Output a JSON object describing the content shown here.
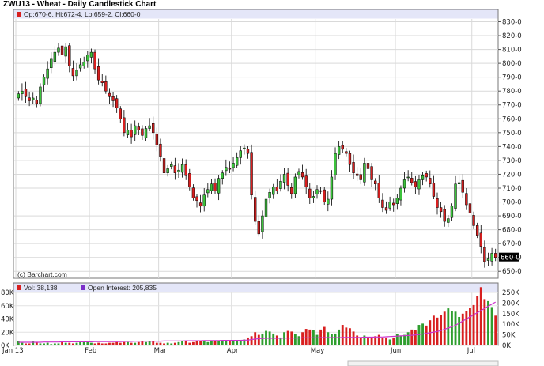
{
  "chart_data": [
    {
      "type": "candlestick",
      "title": "ZWU13 - Wheat - Daily Candlestick Chart",
      "ohlc_label": "Op:670-6, Hi:672-4, Lo:659-2, Cl:660-0",
      "last_price_label": "660-0",
      "copyright": "(c) Barchart.com",
      "x_ticks": [
        "Jan 13",
        "Feb",
        "Mar",
        "Apr",
        "May",
        "Jun",
        "Jul"
      ],
      "y_ticks": [
        "830-0",
        "820-0",
        "810-0",
        "800-0",
        "790-0",
        "780-0",
        "770-0",
        "760-0",
        "750-0",
        "740-0",
        "730-0",
        "720-0",
        "710-0",
        "700-0",
        "690-0",
        "680-0",
        "670-0",
        "660-0",
        "650-0"
      ],
      "ylim": [
        645,
        832
      ],
      "grid": true,
      "colors": {
        "up": "#3cc33c",
        "down": "#d81f1f",
        "wick": "#000000",
        "legend_bg": "#e4e6f8"
      },
      "closes": [
        778,
        780,
        776,
        773,
        775,
        771,
        783,
        790,
        796,
        803,
        808,
        811,
        806,
        812,
        798,
        791,
        795,
        799,
        801,
        806,
        808,
        796,
        788,
        786,
        780,
        776,
        773,
        768,
        760,
        750,
        752,
        747,
        755,
        752,
        748,
        753,
        755,
        750,
        741,
        733,
        721,
        724,
        727,
        721,
        723,
        727,
        719,
        711,
        703,
        701,
        697,
        705,
        709,
        713,
        708,
        717,
        721,
        725,
        724,
        728,
        732,
        737,
        739,
        735,
        705,
        686,
        677,
        690,
        702,
        707,
        711,
        708,
        715,
        720,
        712,
        706,
        718,
        722,
        718,
        711,
        703,
        704,
        709,
        708,
        700,
        702,
        718,
        735,
        740,
        738,
        735,
        727,
        721,
        719,
        716,
        728,
        724,
        716,
        713,
        703,
        696,
        694,
        700,
        698,
        703,
        710,
        716,
        718,
        714,
        711,
        716,
        719,
        718,
        713,
        704,
        696,
        693,
        686,
        688,
        697,
        713,
        714,
        707,
        698,
        692,
        683,
        676,
        668,
        657,
        659,
        663,
        660
      ]
    },
    {
      "type": "bar",
      "title": "",
      "volume_label": "Vol: 38,138",
      "open_interest_label": "Open Interest: 205,835",
      "y_ticks_left": [
        "80K",
        "60K",
        "40K",
        "20K",
        "0K"
      ],
      "y_ticks_right": [
        "250K",
        "200K",
        "150K",
        "100K",
        "50K",
        "0K"
      ],
      "ylim_left": [
        0,
        80000
      ],
      "ylim_right": [
        0,
        250000
      ],
      "oi_color": "#cc33cc",
      "volume": [
        6,
        4,
        3,
        3,
        6,
        5,
        3,
        3,
        4,
        2,
        3,
        3,
        5,
        4,
        4,
        3,
        4,
        5,
        5,
        5,
        4,
        3,
        4,
        3,
        3,
        4,
        4,
        5,
        4,
        5,
        5,
        4,
        4,
        5,
        6,
        5,
        6,
        6,
        4,
        4,
        3,
        4,
        3,
        4,
        5,
        6,
        6,
        4,
        5,
        6,
        7,
        6,
        5,
        6,
        6,
        6,
        6,
        7,
        8,
        7,
        8,
        8,
        9,
        12,
        14,
        20,
        16,
        18,
        22,
        21,
        18,
        15,
        12,
        20,
        22,
        21,
        17,
        14,
        20,
        25,
        24,
        23,
        16,
        24,
        28,
        20,
        17,
        18,
        24,
        31,
        27,
        26,
        21,
        15,
        12,
        15,
        13,
        11,
        14,
        16,
        12,
        11,
        9,
        12,
        17,
        15,
        16,
        20,
        24,
        23,
        31,
        33,
        30,
        38,
        45,
        42,
        46,
        51,
        56,
        52,
        51,
        43,
        48,
        52,
        57,
        61,
        75,
        88,
        70,
        67,
        58,
        45
      ],
      "open_interest": [
        15,
        15,
        15,
        15,
        15,
        15,
        15,
        16,
        16,
        16,
        16,
        16,
        17,
        17,
        17,
        17,
        17,
        17,
        17,
        17,
        17,
        18,
        18,
        18,
        18,
        18,
        18,
        18,
        18,
        19,
        19,
        19,
        20,
        20,
        20,
        20,
        20,
        20,
        20,
        20,
        21,
        21,
        21,
        21,
        21,
        21,
        22,
        22,
        22,
        22,
        22,
        23,
        23,
        23,
        23,
        23,
        24,
        24,
        24,
        24,
        24,
        24,
        25,
        25,
        28,
        30,
        32,
        33,
        34,
        34,
        34,
        34,
        34,
        35,
        35,
        35,
        35,
        35,
        36,
        36,
        36,
        36,
        36,
        37,
        37,
        37,
        37,
        37,
        37,
        38,
        38,
        38,
        38,
        38,
        38,
        39,
        39,
        39,
        40,
        40,
        40,
        41,
        42,
        43,
        44,
        45,
        46,
        47,
        48,
        50,
        52,
        54,
        57,
        60,
        63,
        66,
        70,
        76,
        82,
        88,
        95,
        105,
        115,
        125,
        135,
        145,
        155,
        165,
        175,
        185,
        195,
        205
      ]
    }
  ]
}
